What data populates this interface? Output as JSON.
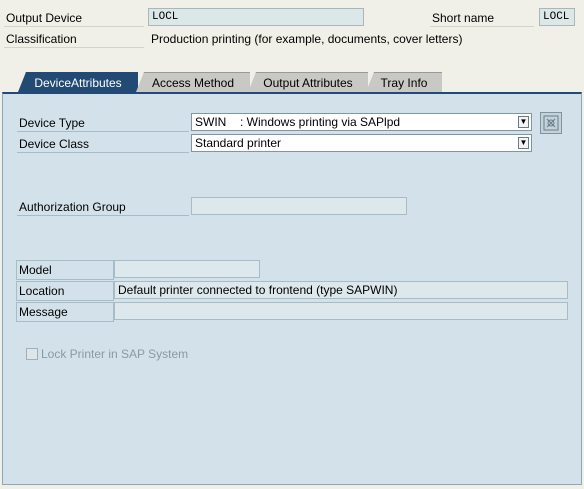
{
  "header": {
    "output_device_label": "Output Device",
    "output_device_value": "LOCL",
    "short_name_label": "Short name",
    "short_name_value": "LOCL",
    "classification_label": "Classification",
    "classification_value": "Production printing (for example, documents, cover letters)"
  },
  "tabs": [
    {
      "label": "DeviceAttributes",
      "active": true
    },
    {
      "label": "Access Method",
      "active": false
    },
    {
      "label": "Output Attributes",
      "active": false
    },
    {
      "label": "Tray Info",
      "active": false
    }
  ],
  "device_attributes": {
    "device_type_label": "Device Type",
    "device_type_code": "SWIN",
    "device_type_desc": ": Windows printing via SAPlpd",
    "device_class_label": "Device Class",
    "device_class_value": "Standard printer",
    "authorization_group_label": "Authorization Group",
    "authorization_group_value": "",
    "model_label": "Model",
    "model_value": "",
    "location_label": "Location",
    "location_value": "Default printer connected to frontend (type SAPWIN)",
    "message_label": "Message",
    "message_value": "",
    "lock_printer_label": "Lock Printer in SAP System",
    "lock_printer_checked": false
  },
  "colors": {
    "active_tab": "#234a74",
    "panel_bg": "#d3e2ea",
    "page_bg": "#f0f0e8"
  }
}
